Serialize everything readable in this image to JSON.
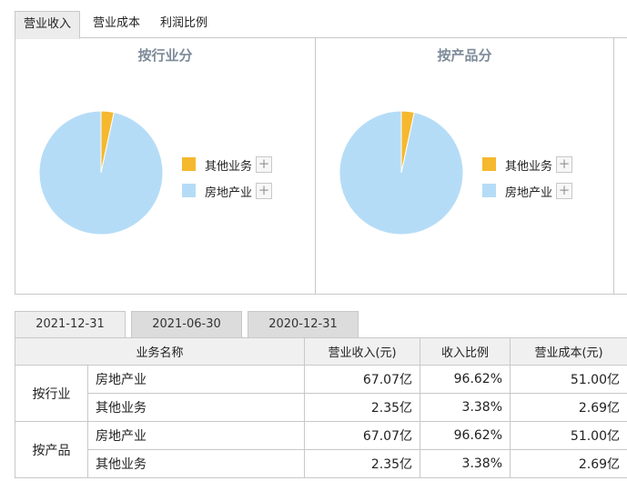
{
  "top_tabs": [
    {
      "label": "营业收入",
      "active": true
    },
    {
      "label": "营业成本",
      "active": false
    },
    {
      "label": "利润比例",
      "active": false
    }
  ],
  "panels": [
    {
      "title": "按行业分"
    },
    {
      "title": "按产品分"
    }
  ],
  "legend": [
    {
      "label": "其他业务",
      "color": "#f5b82e",
      "expand": "+"
    },
    {
      "label": "房地产业",
      "color": "#b5dcf7",
      "expand": "+"
    }
  ],
  "chart_data": [
    {
      "type": "pie",
      "title": "按行业分",
      "slices": [
        {
          "label": "其他业务",
          "value": 3.38,
          "color": "#f5b82e"
        },
        {
          "label": "房地产业",
          "value": 96.62,
          "color": "#b5dcf7"
        }
      ]
    },
    {
      "type": "pie",
      "title": "按产品分",
      "slices": [
        {
          "label": "其他业务",
          "value": 3.38,
          "color": "#f5b82e"
        },
        {
          "label": "房地产业",
          "value": 96.62,
          "color": "#b5dcf7"
        }
      ]
    }
  ],
  "date_tabs": [
    {
      "label": "2021-12-31",
      "active": true
    },
    {
      "label": "2021-06-30",
      "active": false
    },
    {
      "label": "2020-12-31",
      "active": false
    }
  ],
  "table": {
    "headers": {
      "name": "业务名称",
      "revenue": "营业收入(元)",
      "ratio": "收入比例",
      "cost": "营业成本(元)"
    },
    "groups": [
      {
        "label": "按行业",
        "rows": [
          {
            "name": "房地产业",
            "revenue": "67.07亿",
            "ratio": "96.62%",
            "cost": "51.00亿"
          },
          {
            "name": "其他业务",
            "revenue": "2.35亿",
            "ratio": "3.38%",
            "cost": "2.69亿"
          }
        ]
      },
      {
        "label": "按产品",
        "rows": [
          {
            "name": "房地产业",
            "revenue": "67.07亿",
            "ratio": "96.62%",
            "cost": "51.00亿"
          },
          {
            "name": "其他业务",
            "revenue": "2.35亿",
            "ratio": "3.38%",
            "cost": "2.69亿"
          }
        ]
      }
    ]
  }
}
